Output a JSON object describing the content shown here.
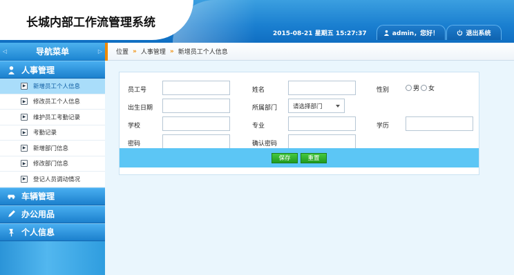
{
  "header": {
    "app_title": "长城内部工作流管理系统",
    "datetime": "2015-08-21 星期五 15:27:37",
    "user_label": "admin，您好！",
    "logout_label": "退出系统"
  },
  "sidebar": {
    "nav_title": "导航菜单",
    "sections": [
      {
        "label": "人事管理",
        "icon": "person-icon"
      },
      {
        "label": "车辆管理",
        "icon": "car-icon"
      },
      {
        "label": "办公用品",
        "icon": "pencil-icon"
      },
      {
        "label": "个人信息",
        "icon": "pin-icon"
      }
    ],
    "items": [
      {
        "label": "新增员工个人信息"
      },
      {
        "label": "修改员工个人信息"
      },
      {
        "label": "维护员工考勤记录"
      },
      {
        "label": "考勤记录"
      },
      {
        "label": "新增部门信息"
      },
      {
        "label": "修改部门信息"
      },
      {
        "label": "登记人员调动情况"
      }
    ],
    "active_item": "新增员工个人信息"
  },
  "breadcrumb": {
    "items": [
      "位置",
      "人事管理",
      "新增员工个人信息"
    ],
    "separator": "»"
  },
  "form": {
    "employee_id": {
      "label": "员工号",
      "value": ""
    },
    "name": {
      "label": "姓名",
      "value": ""
    },
    "gender": {
      "label": "性别",
      "options": [
        "男",
        "女"
      ]
    },
    "birth_date": {
      "label": "出生日期",
      "value": ""
    },
    "department": {
      "label": "所属部门",
      "selected": "请选择部门"
    },
    "school": {
      "label": "学校",
      "value": ""
    },
    "major": {
      "label": "专业",
      "value": ""
    },
    "education": {
      "label": "学历",
      "value": ""
    },
    "password": {
      "label": "密码",
      "value": ""
    },
    "confirm_password": {
      "label": "确认密码",
      "value": ""
    },
    "save_label": "保存",
    "reset_label": "重置"
  },
  "colors": {
    "header_blue": "#1a7fd0",
    "sidebar_blue": "#2b94d8",
    "active_item": "#a9ddfa",
    "button_green": "#2aa326",
    "breadcrumb_accent": "#f08a00"
  }
}
